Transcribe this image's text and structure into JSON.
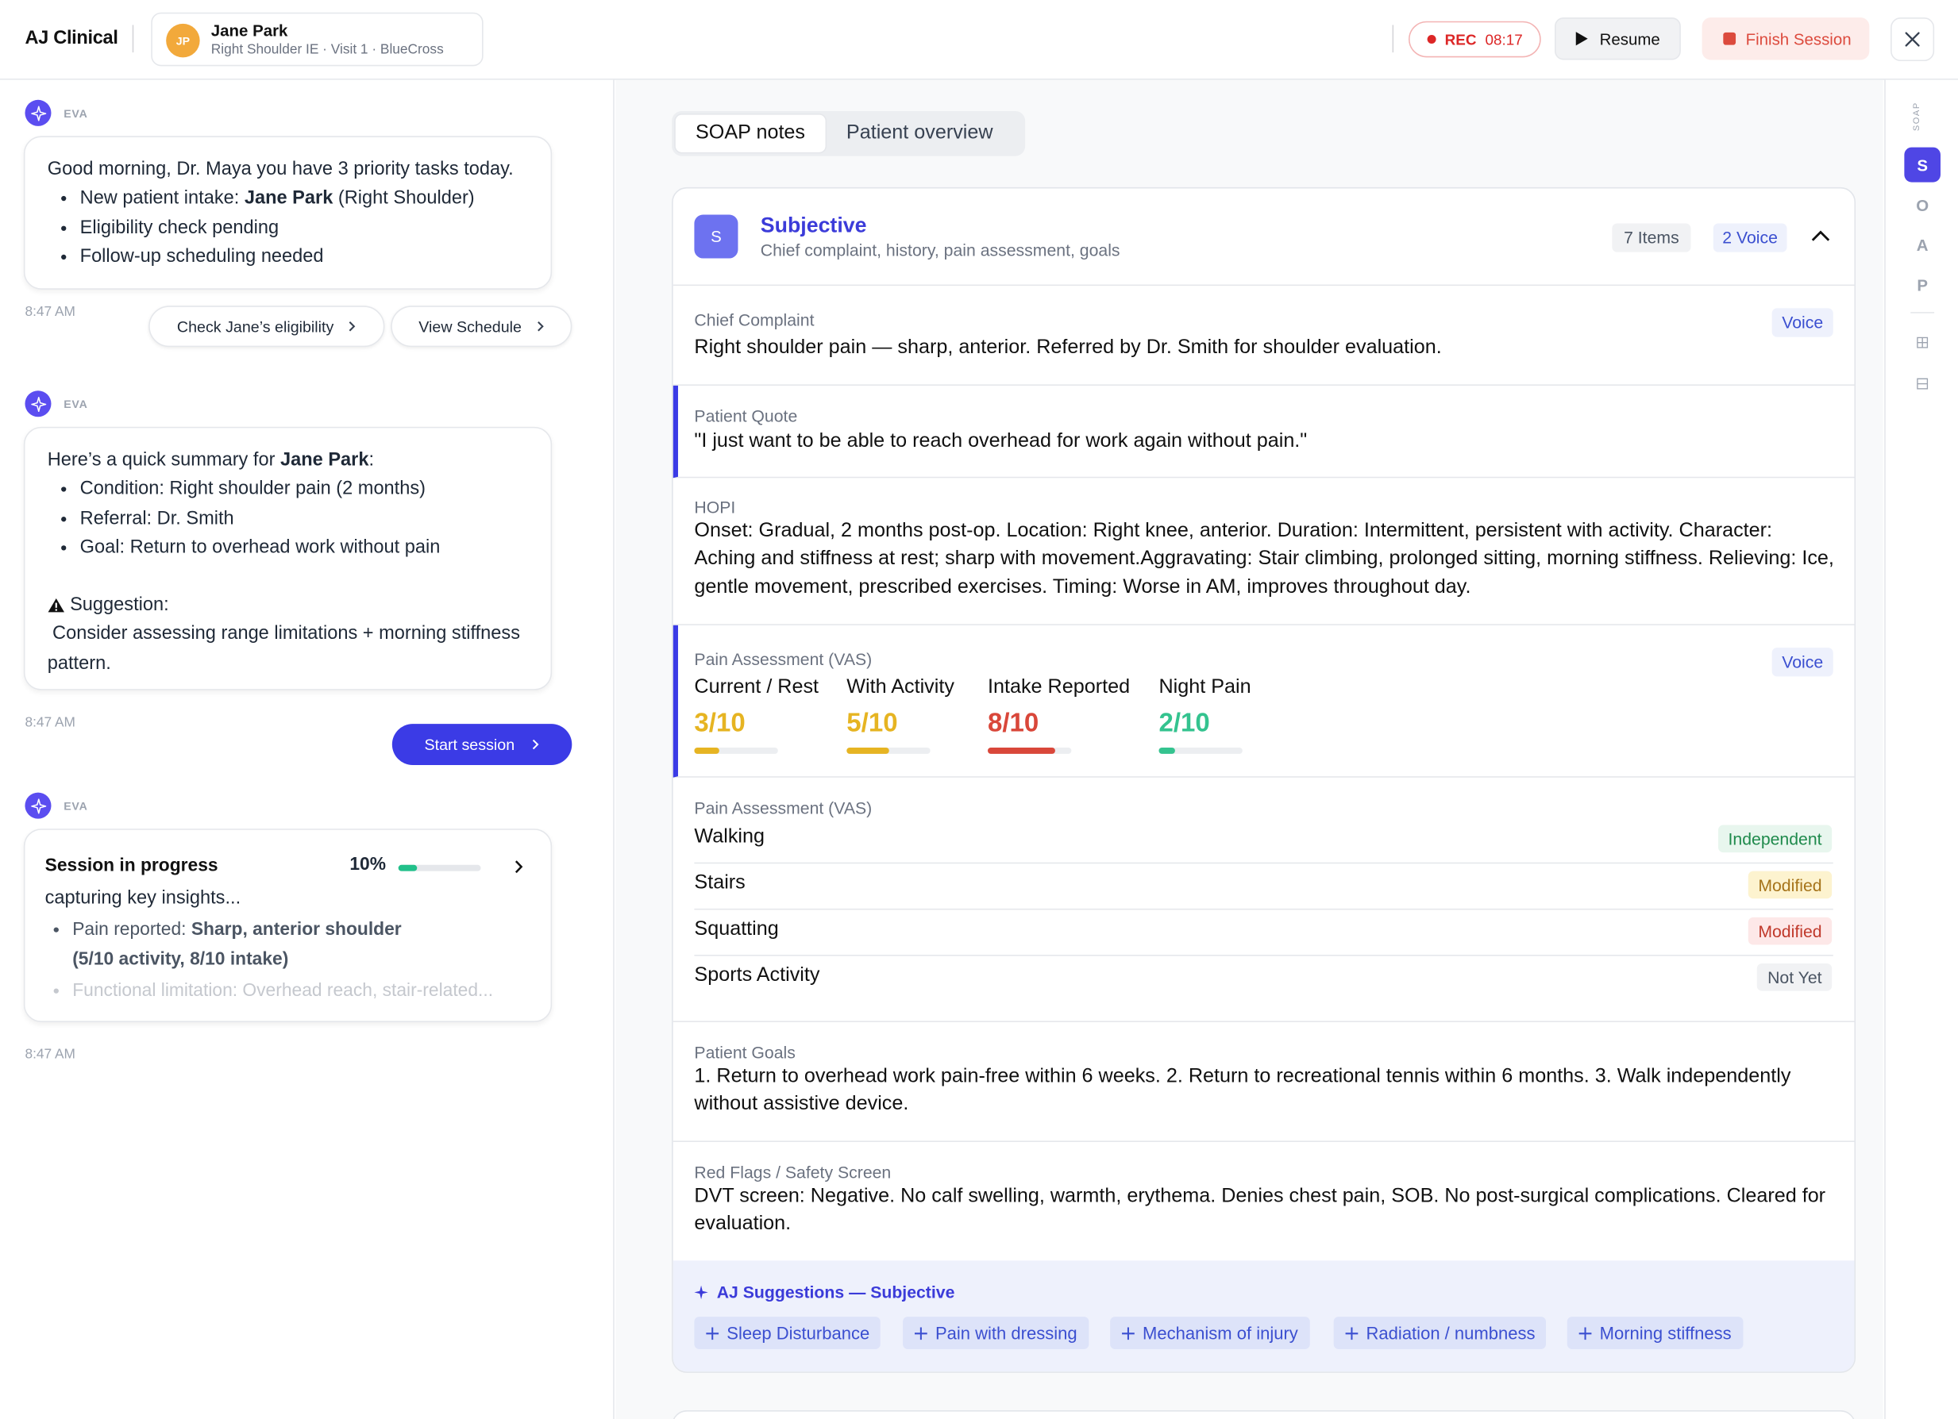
{
  "header": {
    "brand": "AJ Clinical",
    "patient": {
      "initials": "JP",
      "name": "Jane Park",
      "subtitle": "Right Shoulder IE · Visit 1 · BlueCross"
    },
    "rec_label": "REC",
    "rec_time": "08:17",
    "resume_label": "Resume",
    "finish_label": "Finish Session"
  },
  "chat": {
    "agent_name": "EVA",
    "messages": [
      {
        "intro_pre": "Good morning, Dr. Maya you have 3 priority tasks today.",
        "items": [
          {
            "pre": "New patient intake: ",
            "bold": "Jane Park",
            "post": " (Right Shoulder)"
          },
          {
            "pre": "Eligibility check pending"
          },
          {
            "pre": "Follow-up scheduling needed"
          }
        ],
        "time": "8:47 AM",
        "actions": [
          "Check Jane’s eligibility",
          "View Schedule"
        ]
      },
      {
        "intro_pre": "Here’s a quick summary for ",
        "intro_bold": "Jane Park",
        "intro_post": ":",
        "items": [
          {
            "pre": "Condition: Right shoulder pain (2 months)"
          },
          {
            "pre": "Referral: Dr. Smith"
          },
          {
            "pre": "Goal: Return to overhead work without pain"
          }
        ],
        "suggestion_label": "Suggestion:",
        "suggestion_text": "Consider assessing range limitations + morning stiffness pattern.",
        "time": "8:47 AM",
        "action": "Start session"
      },
      {
        "title": "Session in progress",
        "percent_label": "10%",
        "progress": 0.1,
        "subtitle": "capturing key insights...",
        "item1_pre": "Pain reported: ",
        "item1_bold": "Sharp, anterior shoulder (5/10 activity, 8/10 intake)",
        "item2": "Functional limitation: Overhead reach, stair-related...",
        "time": "8:47 AM"
      }
    ]
  },
  "tabs": [
    "SOAP notes",
    "Patient overview"
  ],
  "section": {
    "badge": "S",
    "title": "Subjective",
    "subtitle": "Chief complaint, history, pain assessment, goals",
    "items_count": "7 Items",
    "voice_count": "2 Voice",
    "chief": {
      "label": "Chief Complaint",
      "text": "Right shoulder pain — sharp, anterior. Referred by Dr. Smith for shoulder evaluation.",
      "tag": "Voice"
    },
    "quote": {
      "label": "Patient Quote",
      "text": "\"I just want to be able to reach overhead for work again without pain.\""
    },
    "hopi": {
      "label": "HOPI",
      "text": "Onset: Gradual, 2 months post-op. Location: Right knee, anterior. Duration: Intermittent, persistent with activity. Character: Aching and stiffness at rest; sharp with movement.Aggravating: Stair climbing, prolonged sitting, morning stiffness. Relieving: Ice, gentle movement, prescribed exercises. Timing: Worse in AM, improves throughout day."
    },
    "vas": {
      "label": "Pain Assessment (VAS)",
      "tag": "Voice",
      "items": [
        {
          "name": "Current / Rest",
          "score": "3/10",
          "value": 3,
          "color": "#e6b422"
        },
        {
          "name": "With Activity",
          "score": "5/10",
          "value": 5,
          "color": "#e6b422"
        },
        {
          "name": "Intake Reported",
          "score": "8/10",
          "value": 8,
          "color": "#d9473a"
        },
        {
          "name": "Night Pain",
          "score": "2/10",
          "value": 2,
          "color": "#34c38f"
        }
      ]
    },
    "functional": {
      "label": "Pain Assessment (VAS)",
      "rows": [
        {
          "name": "Walking",
          "status": "Independent",
          "bg": "#e8f6ee",
          "fg": "#1f8a4c"
        },
        {
          "name": "Stairs",
          "status": "Modified",
          "bg": "#fdf3cf",
          "fg": "#a6741a"
        },
        {
          "name": "Squatting",
          "status": "Modified",
          "bg": "#fde8e8",
          "fg": "#c0392b"
        },
        {
          "name": "Sports Activity",
          "status": "Not Yet",
          "bg": "#f1f2f4",
          "fg": "#4b5563"
        }
      ]
    },
    "goals": {
      "label": "Patient Goals",
      "text": "1. Return to overhead work pain-free within 6 weeks. 2. Return to recreational tennis within 6 months. 3. Walk independently without assistive device."
    },
    "redflags": {
      "label": "Red Flags / Safety Screen",
      "text": "DVT screen: Negative. No calf swelling, warmth, erythema. Denies chest pain, SOB. No post-surgical complications. Cleared for evaluation."
    },
    "suggestions": {
      "title": "AJ Suggestions — Subjective",
      "chips": [
        "Sleep Disturbance",
        "Pain with dressing",
        "Mechanism of injury",
        "Radiation / numbness",
        "Morning stiffness"
      ]
    }
  },
  "rail": {
    "label": "SOAP",
    "letters": [
      "S",
      "O",
      "A",
      "P"
    ]
  }
}
